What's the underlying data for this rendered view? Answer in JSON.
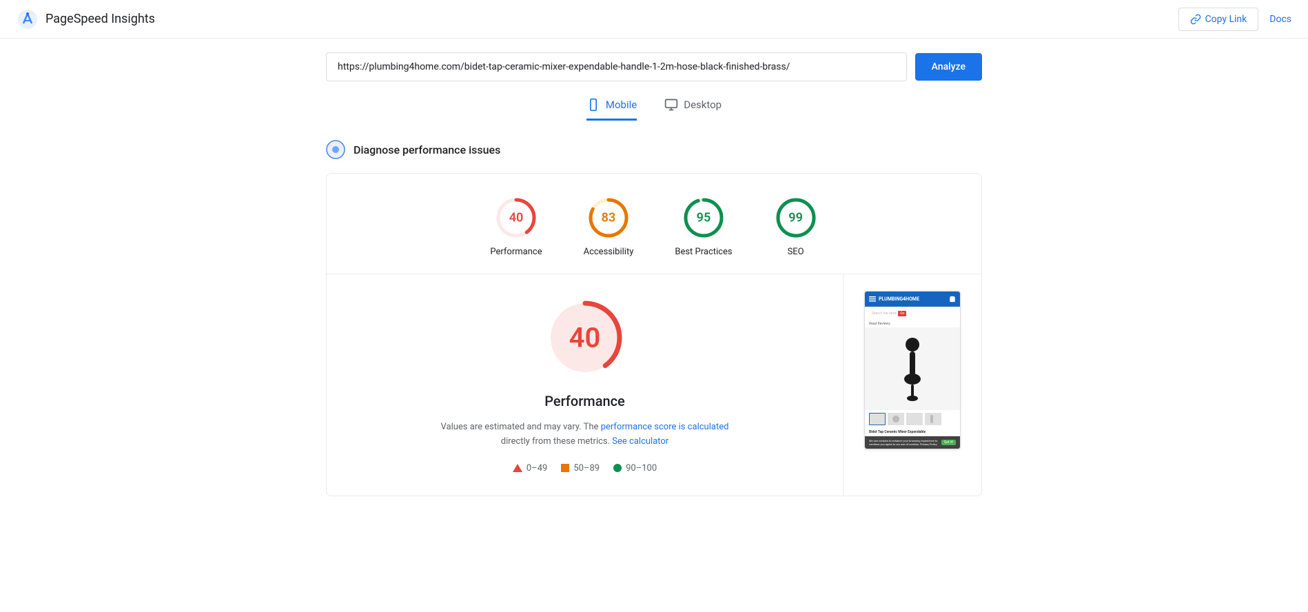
{
  "header": {
    "title": "PageSpeed Insights",
    "copy_link_label": "Copy Link",
    "docs_label": "Docs"
  },
  "url_bar": {
    "url_value": "https://plumbing4home.com/bidet-tap-ceramic-mixer-expendable-handle-1-2m-hose-black-finished-brass/",
    "analyze_label": "Analyze"
  },
  "tabs": [
    {
      "id": "mobile",
      "label": "Mobile",
      "active": true
    },
    {
      "id": "desktop",
      "label": "Desktop",
      "active": false
    }
  ],
  "diagnose": {
    "title": "Diagnose performance issues"
  },
  "scores": [
    {
      "id": "performance",
      "value": 40,
      "label": "Performance",
      "color": "red",
      "pct": 40
    },
    {
      "id": "accessibility",
      "value": 83,
      "label": "Accessibility",
      "color": "orange",
      "pct": 83
    },
    {
      "id": "best-practices",
      "value": 95,
      "label": "Best Practices",
      "color": "green",
      "pct": 95
    },
    {
      "id": "seo",
      "value": 99,
      "label": "SEO",
      "color": "green",
      "pct": 99
    }
  ],
  "detail": {
    "score": 40,
    "title": "Performance",
    "description_start": "Values are estimated and may vary. The",
    "description_link1": "performance score is calculated",
    "description_middle": "directly from these metrics.",
    "description_link2": "See calculator",
    "legend": [
      {
        "type": "triangle",
        "range": "0–49"
      },
      {
        "type": "square",
        "range": "50–89"
      },
      {
        "type": "circle",
        "range": "90–100"
      }
    ]
  },
  "screenshot": {
    "header_text": "PLUMBING4HOME",
    "product_title": "Bidet Tap Ceramic Mixer Expendable",
    "cookie_text": "We use cookies to enhance your browsing experience to continue you agree to our use of cookies. Privacy Policy",
    "cookie_btn": "Got it!"
  }
}
